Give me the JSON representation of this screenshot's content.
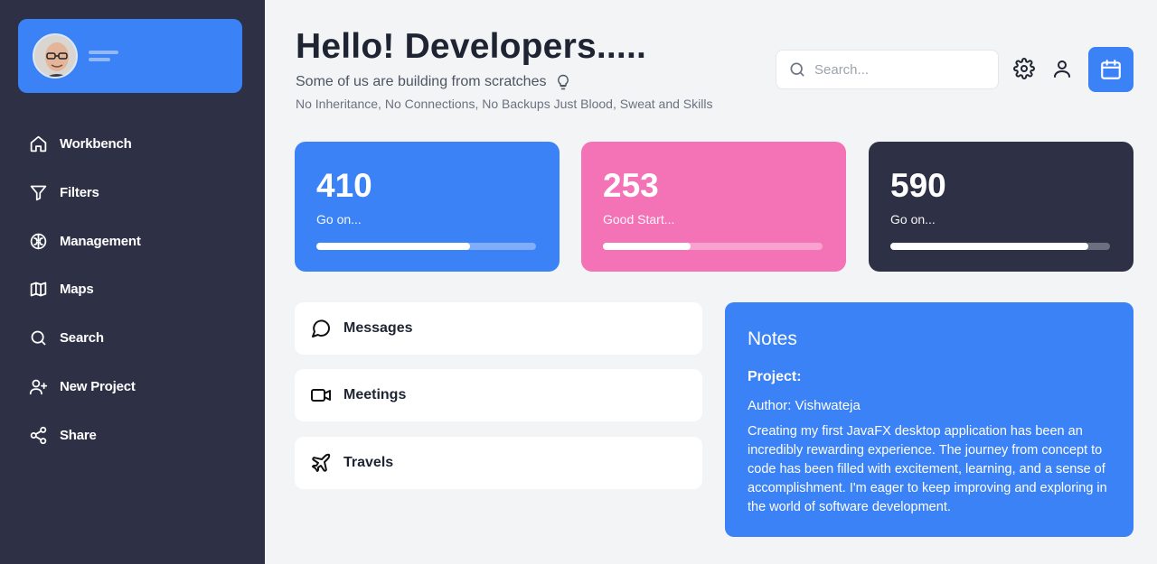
{
  "sidebar": {
    "items": [
      {
        "label": "Workbench",
        "icon": "home-icon"
      },
      {
        "label": "Filters",
        "icon": "filter-icon"
      },
      {
        "label": "Management",
        "icon": "brain-icon"
      },
      {
        "label": "Maps",
        "icon": "map-icon"
      },
      {
        "label": "Search",
        "icon": "search-icon"
      },
      {
        "label": "New Project",
        "icon": "user-plus-icon"
      },
      {
        "label": "Share",
        "icon": "share-icon"
      }
    ]
  },
  "header": {
    "title": "Hello! Developers.....",
    "subtitle": "Some of us are building from scratches",
    "tagline": "No Inheritance, No Connections, No Backups Just Blood, Sweat and Skills",
    "search_placeholder": "Search..."
  },
  "stats": [
    {
      "value": "410",
      "label": "Go on...",
      "progress": 0.7,
      "color": "#3b82f6"
    },
    {
      "value": "253",
      "label": "Good Start...",
      "progress": 0.4,
      "color": "#f472b6"
    },
    {
      "value": "590",
      "label": "Go on...",
      "progress": 0.9,
      "color": "#2e3146"
    }
  ],
  "cards": [
    {
      "label": "Messages",
      "icon": "message-circle-icon"
    },
    {
      "label": "Meetings",
      "icon": "video-icon"
    },
    {
      "label": "Travels",
      "icon": "plane-icon"
    }
  ],
  "notes": {
    "title": "Notes",
    "project_label": "Project:",
    "author": "Author: Vishwateja",
    "body": "Creating my first JavaFX desktop application has been an incredibly rewarding experience. The journey from concept to code has been filled with excitement, learning, and a sense of accomplishment. I'm eager to keep improving and exploring in the world of software development."
  },
  "colors": {
    "sidebar": "#2e3146",
    "accent": "#3b82f6",
    "pink": "#f472b6",
    "background": "#f3f4f6"
  }
}
